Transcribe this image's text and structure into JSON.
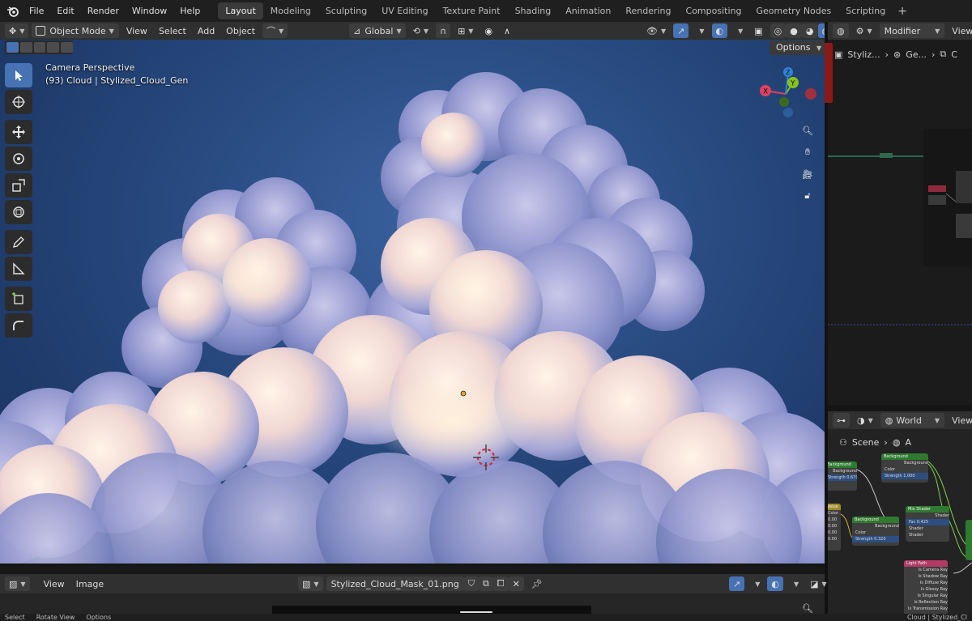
{
  "topbar": {
    "menu": [
      "File",
      "Edit",
      "Render",
      "Window",
      "Help"
    ],
    "workspaces": [
      "Layout",
      "Modeling",
      "Sculpting",
      "UV Editing",
      "Texture Paint",
      "Shading",
      "Animation",
      "Rendering",
      "Compositing",
      "Geometry Nodes",
      "Scripting"
    ],
    "active_workspace": "Layout",
    "add_workspace": "+"
  },
  "viewport_header": {
    "mode": "Object Mode",
    "menus": [
      "View",
      "Select",
      "Add",
      "Object"
    ],
    "orientation": "Global"
  },
  "viewport": {
    "perspective_label": "Camera Perspective",
    "object_label": "(93) Cloud | Stylized_Cloud_Gen",
    "options_label": "Options",
    "gizmo": {
      "x": "X",
      "y": "Y",
      "z": "Z"
    }
  },
  "properties_header": {
    "modifier_label": "Modifier",
    "view_label": "View",
    "s_label": "S"
  },
  "properties_breadcrumb": {
    "item1": "Styliz...",
    "item2": "Ge...",
    "item3": "C"
  },
  "world_header": {
    "world_label": "World",
    "view_label": "View"
  },
  "world_breadcrumb": {
    "scene": "Scene",
    "item": "A"
  },
  "image_editor": {
    "menus": [
      "View",
      "Image"
    ],
    "image_name": "Stylized_Cloud_Mask_01.png"
  },
  "statusbar": {
    "items": [
      "Select",
      "Rotate View",
      "Options"
    ],
    "right": "Cloud | Stylized_Cl"
  },
  "nodes": {
    "background_top_left": {
      "title": "Background",
      "field": "Background",
      "strength": "Strength  0.670"
    },
    "value_node": {
      "title": "Value",
      "field": "Color",
      "values": [
        "0.00",
        "0.00",
        "0.00",
        "0.00"
      ]
    },
    "background_1": {
      "title": "Background",
      "field": "Background",
      "color": "Color",
      "strength": "Strength  1.000"
    },
    "background_2": {
      "title": "Background",
      "field": "Background",
      "color": "Color",
      "strength": "Strength  0.320"
    },
    "mix_shader": {
      "title": "Mix Shader",
      "field": "Shader",
      "fac": "Fac",
      "fac_value": "0.425",
      "shader_a": "Shader",
      "shader_b": "Shader"
    },
    "light_path": {
      "title": "Light Path",
      "outputs": [
        "Is Camera Ray",
        "Is Shadow Ray",
        "Is Diffuse Ray",
        "Is Glossy Ray",
        "Is Singular Ray",
        "Is Reflection Ray",
        "Is Transmission Ray"
      ]
    }
  },
  "colors": {
    "accent": "#4772b3",
    "node_green": "#2f7a2f",
    "node_pink": "#b23a64",
    "axis_x": "#e0425f",
    "axis_y": "#86c21b",
    "axis_z": "#2f83d6"
  }
}
